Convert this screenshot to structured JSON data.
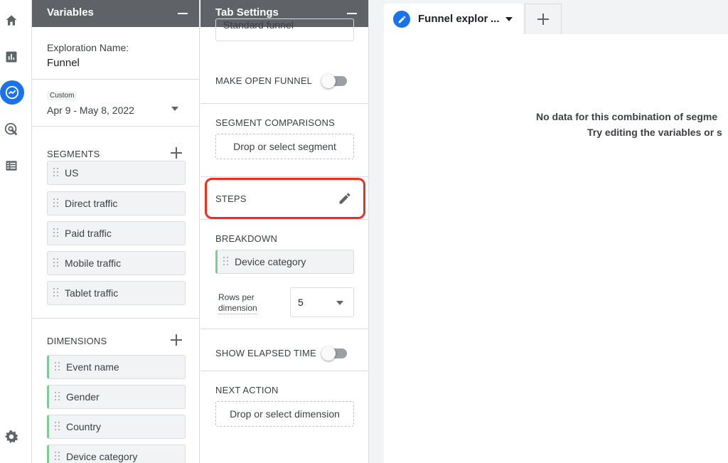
{
  "rail": {
    "icons": [
      "home-icon",
      "reports-icon",
      "explore-icon",
      "advertising-icon",
      "configure-icon",
      "settings-icon"
    ]
  },
  "variables": {
    "title": "Variables",
    "exploration_name_label": "Exploration Name:",
    "exploration_name_value": "Funnel",
    "date_badge": "Custom",
    "date_range": "Apr 9 - May 8, 2022",
    "segments_label": "SEGMENTS",
    "segments": [
      "US",
      "Direct traffic",
      "Paid traffic",
      "Mobile traffic",
      "Tablet traffic"
    ],
    "dimensions_label": "DIMENSIONS",
    "dimensions": [
      "Event name",
      "Gender",
      "Country",
      "Device category"
    ]
  },
  "tab_settings": {
    "title": "Tab Settings",
    "funnel_type_value": "Standard funnel",
    "make_open_funnel_label": "MAKE OPEN FUNNEL",
    "segment_comparisons_label": "SEGMENT COMPARISONS",
    "segment_drop_placeholder": "Drop or select segment",
    "steps_label": "STEPS",
    "breakdown_label": "BREAKDOWN",
    "breakdown_value": "Device category",
    "rows_per_dimension_label_line1": "Rows per",
    "rows_per_dimension_label_line2": "dimension",
    "rows_per_dimension_value": "5",
    "show_elapsed_time_label": "SHOW ELAPSED TIME",
    "next_action_label": "NEXT ACTION",
    "dimension_drop_placeholder": "Drop or select dimension"
  },
  "canvas": {
    "tab_label": "Funnel explor",
    "tab_ellipsis": "...",
    "no_data_line1": "No data for this combination of segme",
    "no_data_line2": "Try editing the variables or s"
  },
  "colors": {
    "accent": "#1a73e8",
    "header": "#5f6368",
    "highlight": "#e8321e",
    "dimension_bar": "#81c995"
  }
}
